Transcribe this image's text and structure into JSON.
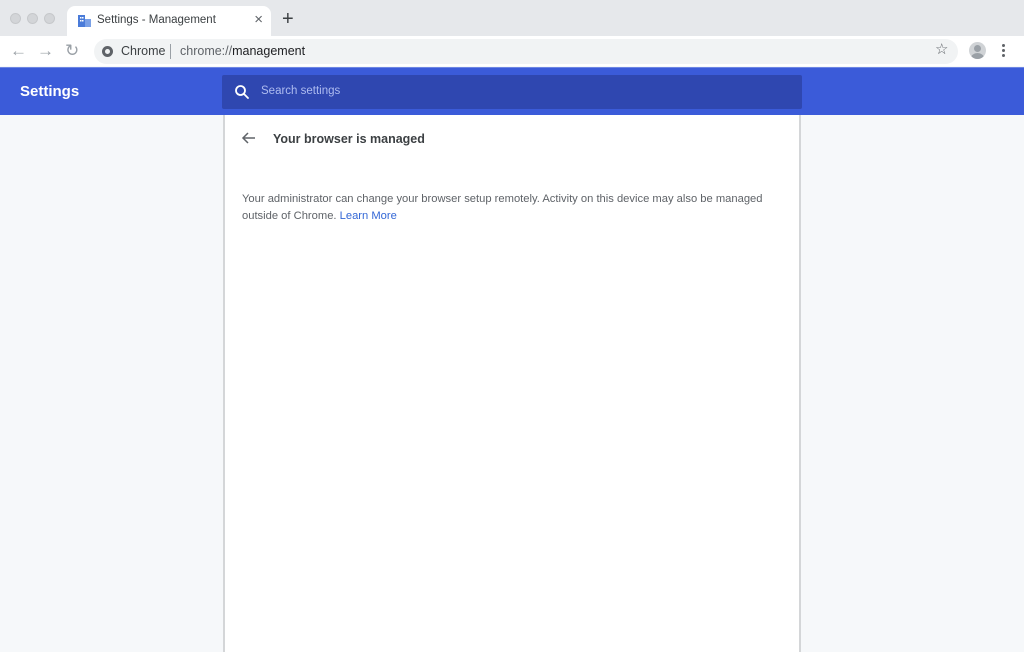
{
  "browser": {
    "tab": {
      "title": "Settings - Management",
      "close_glyph": "×",
      "icon": "building-icon"
    },
    "new_tab_glyph": "+",
    "nav": {
      "back_glyph": "←",
      "forward_glyph": "→",
      "reload_glyph": "↻"
    },
    "omnibox": {
      "label": "Chrome",
      "url_scheme": "chrome://",
      "url_host": "management"
    },
    "bookmark_glyph": "☆"
  },
  "settings": {
    "header_title": "Settings",
    "search_placeholder": "Search settings",
    "accent_color": "#3b5bd9"
  },
  "page": {
    "title": "Your browser is managed",
    "description": "Your administrator can change your browser setup remotely. Activity on this device may also be managed outside of Chrome.",
    "learn_more": "Learn More",
    "link_color": "#3367d6"
  }
}
